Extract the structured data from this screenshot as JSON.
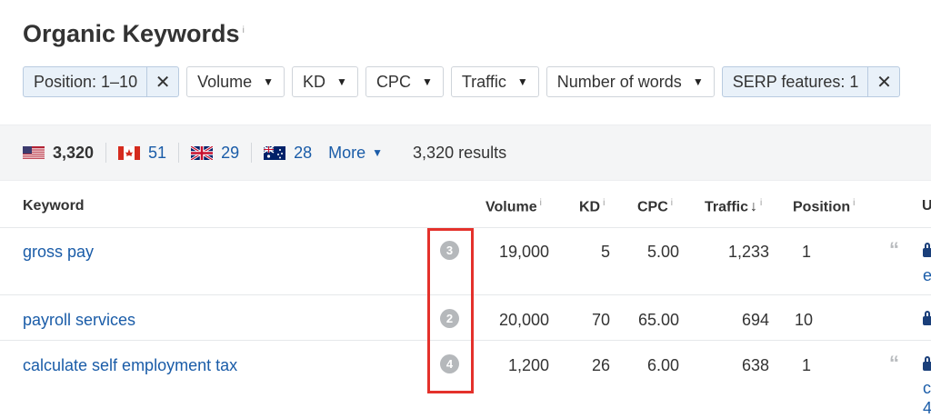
{
  "page_title": "Organic Keywords",
  "title_info": "i",
  "filters": [
    {
      "label": "Position: 1–10",
      "active": true,
      "close": "✕"
    },
    {
      "label": "Volume",
      "caret": "▼"
    },
    {
      "label": "KD",
      "caret": "▼"
    },
    {
      "label": "CPC",
      "caret": "▼"
    },
    {
      "label": "Traffic",
      "caret": "▼"
    },
    {
      "label": "Number of words",
      "caret": "▼"
    },
    {
      "label": "SERP features: 1",
      "active": true,
      "close": "✕"
    }
  ],
  "countries": [
    {
      "flag": "us-flag-icon",
      "count": "3,320"
    },
    {
      "flag": "canada-flag-icon",
      "count": "51"
    },
    {
      "flag": "uk-flag-icon",
      "count": "29"
    },
    {
      "flag": "australia-flag-icon",
      "count": "28"
    }
  ],
  "more_label": "More",
  "more_caret": "▼",
  "results_label": "3,320 results",
  "columns": {
    "keyword": "Keyword",
    "volume": "Volume",
    "kd": "KD",
    "cpc": "CPC",
    "traffic": "Traffic",
    "traffic_sort": "↓",
    "position": "Position",
    "clipped": "U",
    "info": "i"
  },
  "rows": [
    {
      "keyword": "gross pay",
      "badge": "3",
      "volume": "19,000",
      "kd": "5",
      "cpc": "5.00",
      "traffic": "1,233",
      "position": "1",
      "quote": "“",
      "clipped": "e"
    },
    {
      "keyword": "payroll services",
      "badge": "2",
      "volume": "20,000",
      "kd": "70",
      "cpc": "65.00",
      "traffic": "694",
      "position": "10",
      "quote": "",
      "clipped": ""
    },
    {
      "keyword": "calculate self employment tax",
      "badge": "4",
      "volume": "1,200",
      "kd": "26",
      "cpc": "6.00",
      "traffic": "638",
      "position": "1",
      "quote": "“",
      "clipped": "c",
      "clipped2": "4"
    }
  ],
  "colors": {
    "link": "#1a5ca8",
    "highlight_box": "#e4312b",
    "badge": "#b5b8bb"
  }
}
